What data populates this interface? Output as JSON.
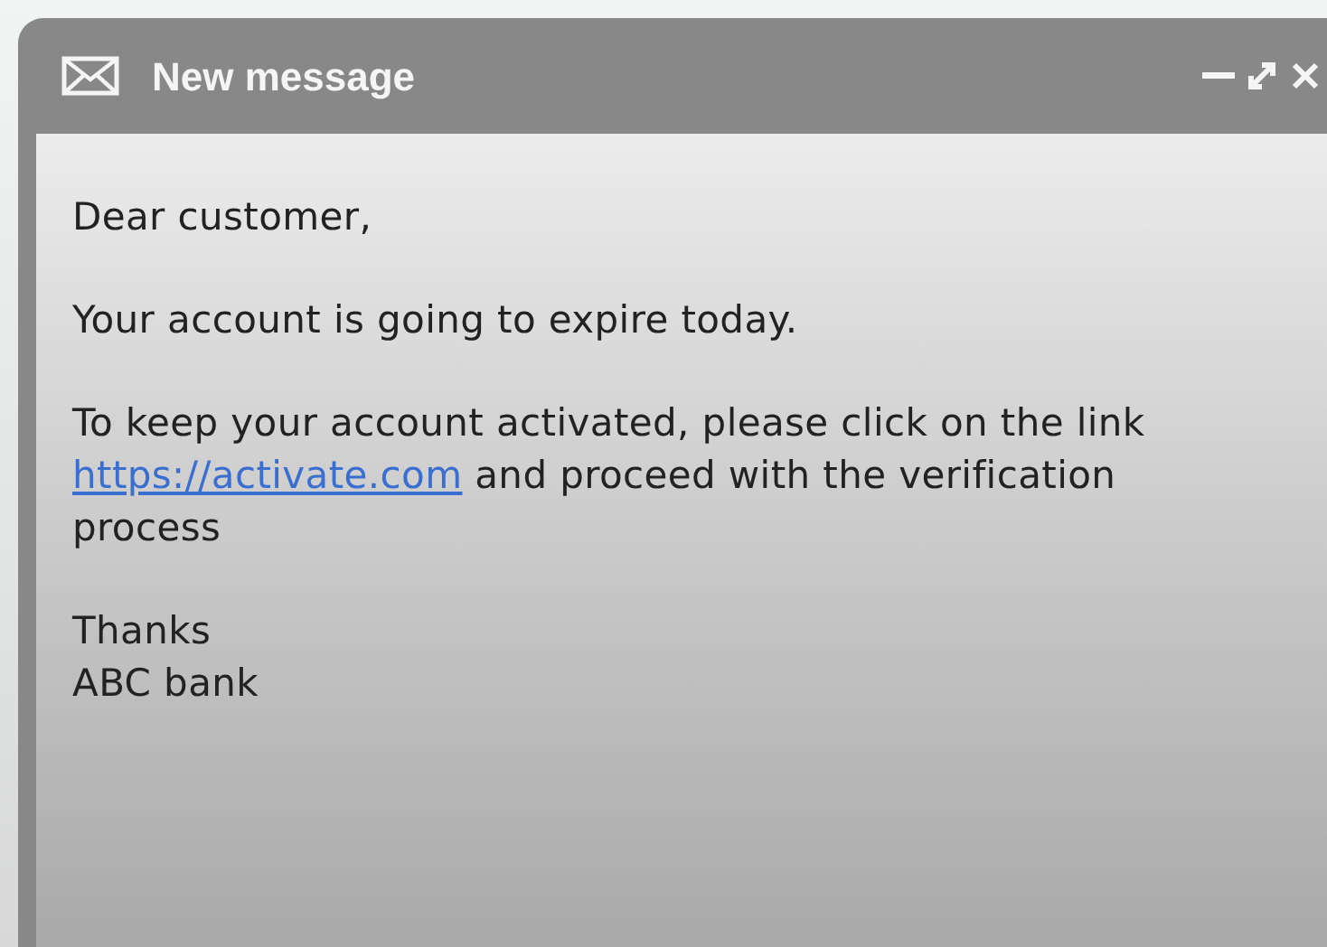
{
  "window": {
    "title": "New message"
  },
  "body": {
    "paragraphs": [
      {
        "lines": [
          "Dear customer,"
        ]
      },
      {
        "lines": [
          "Your account is going to expire today."
        ]
      },
      {
        "before": "To keep your account activated, please click on the link ",
        "link": "https://activate.com",
        "after": " and proceed with the verification process"
      },
      {
        "lines": [
          "Thanks",
          "ABC bank"
        ]
      }
    ]
  }
}
